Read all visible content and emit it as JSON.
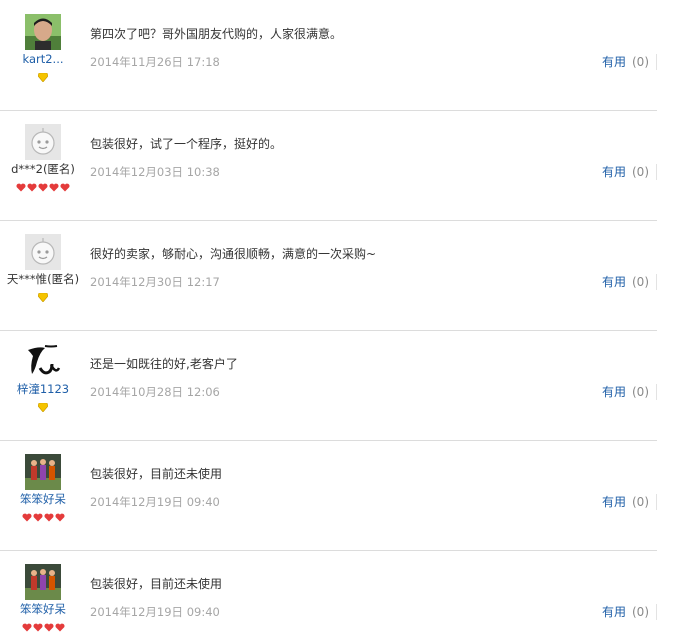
{
  "colors": {
    "link": "#1f5fa8",
    "date": "#a6a6a6",
    "divider": "#dcdcdc",
    "rank_diamond_yellow": "#f5c400",
    "rank_heart_red": "#e43b3b"
  },
  "reviews": [
    {
      "avatar": "photo-avatar",
      "username": "kart2...",
      "content": "第四次了吧？哥外国朋友代购的，人家很满意。",
      "date": "2014年11月26日 17:18",
      "useful_label": "有用",
      "useful_count": "(0)",
      "rank_icon": "yellow-diamond-icon",
      "rank_count": 1
    },
    {
      "avatar": "default-avatar",
      "username": "d***2(匿名)",
      "content": "包装很好，试了一个程序，挺好的。",
      "date": "2014年12月03日 10:38",
      "useful_label": "有用",
      "useful_count": "(0)",
      "rank_icon": "red-heart-icon",
      "rank_count": 5
    },
    {
      "avatar": "default-avatar",
      "username": "天***惟(匿名)",
      "content": "很好的卖家，够耐心，沟通很顺畅，满意的一次采购~",
      "date": "2014年12月30日 12:17",
      "useful_label": "有用",
      "useful_count": "(0)",
      "rank_icon": "yellow-diamond-icon",
      "rank_count": 1
    },
    {
      "avatar": "brush-avatar",
      "username": "梓潼1123",
      "content": "还是一如既往的好,老客户了",
      "date": "2014年10月28日 12:06",
      "useful_label": "有用",
      "useful_count": "(0)",
      "rank_icon": "yellow-diamond-icon",
      "rank_count": 1
    },
    {
      "avatar": "group-photo-avatar",
      "username": "笨笨好呆",
      "content": "包装很好，目前还未使用",
      "date": "2014年12月19日 09:40",
      "useful_label": "有用",
      "useful_count": "(0)",
      "rank_icon": "red-heart-icon",
      "rank_count": 4
    },
    {
      "avatar": "group-photo-avatar",
      "username": "笨笨好呆",
      "content": "包装很好，目前还未使用",
      "date": "2014年12月19日 09:40",
      "useful_label": "有用",
      "useful_count": "(0)",
      "rank_icon": "red-heart-icon",
      "rank_count": 4
    }
  ]
}
